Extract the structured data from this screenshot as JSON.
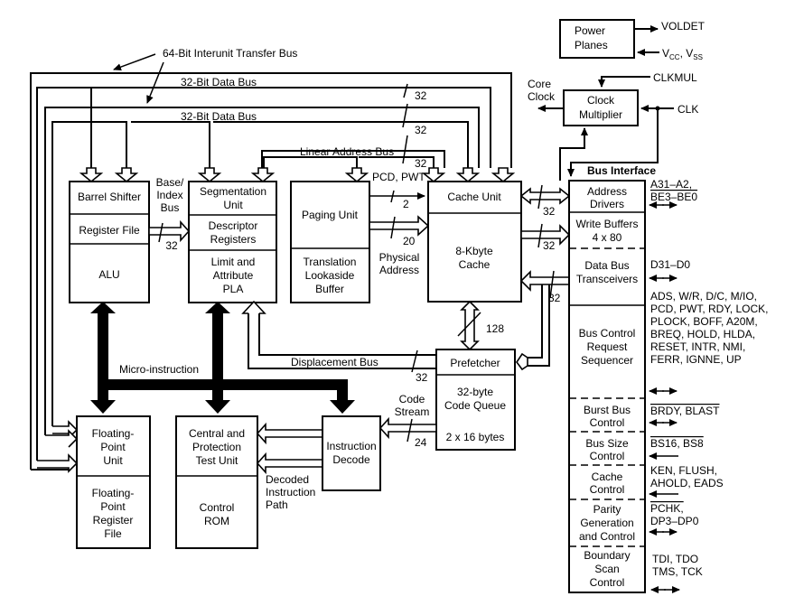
{
  "title_annotation": "64-Bit Interunit Transfer Bus",
  "buses": {
    "data_bus_1": "32-Bit Data Bus",
    "data_bus_2": "32-Bit Data Bus",
    "linear_address_bus": "Linear Address Bus",
    "displacement_bus": "Displacement Bus",
    "micro_instruction": "Micro-instruction",
    "base_index_bus": [
      "Base/",
      "Index",
      "Bus"
    ],
    "physical_address": [
      "Physical",
      "Address"
    ],
    "pcd_pwt": "PCD, PWT",
    "code_stream": [
      "Code",
      "Stream"
    ],
    "decoded_instruction_path": [
      "Decoded",
      "Instruction",
      "Path"
    ],
    "core_clock": [
      "Core",
      "Clock"
    ]
  },
  "widths": {
    "w32_a": "32",
    "w32_b": "32",
    "w32_c": "32",
    "w32_base": "32",
    "w2": "2",
    "w20": "20",
    "w32_bi1": "32",
    "w32_bi2": "32",
    "w32_bi3": "32",
    "w128": "128",
    "w32_disp": "32",
    "w24": "24"
  },
  "blocks": {
    "barrel_shifter": [
      "Barrel Shifter"
    ],
    "register_file": [
      "Register File"
    ],
    "alu": [
      "ALU"
    ],
    "segmentation_unit": [
      "Segmentation",
      "Unit"
    ],
    "descriptor_registers": [
      "Descriptor",
      "Registers"
    ],
    "limit_attribute_pla": [
      "Limit and",
      "Attribute",
      "PLA"
    ],
    "paging_unit": [
      "Paging Unit"
    ],
    "tlb": [
      "Translation",
      "Lookaside",
      "Buffer"
    ],
    "cache_unit": [
      "Cache Unit"
    ],
    "cache_8k": [
      "8-Kbyte",
      "Cache"
    ],
    "prefetcher": [
      "Prefetcher"
    ],
    "code_queue": [
      "32-byte",
      "Code Queue"
    ],
    "code_queue_size": [
      "2 x 16 bytes"
    ],
    "instruction_decode": [
      "Instruction",
      "Decode"
    ],
    "fpu": [
      "Floating-",
      "Point",
      "Unit"
    ],
    "fp_register_file": [
      "Floating-",
      "Point",
      "Register",
      "File"
    ],
    "central_protection": [
      "Central and",
      "Protection",
      "Test Unit"
    ],
    "control_rom": [
      "Control",
      "ROM"
    ],
    "power_planes": [
      "Power",
      "Planes"
    ],
    "clock_multiplier": [
      "Clock",
      "Multiplier"
    ]
  },
  "power": {
    "voldet": "VOLDET",
    "vcc_vss": "V",
    "vcc_sub": "CC",
    "vss_sub": "SS"
  },
  "clock": {
    "clkmul": "CLKMUL",
    "clk": "CLK"
  },
  "bus_interface": {
    "title": "Bus Interface",
    "sections": [
      [
        "Address",
        "Drivers"
      ],
      [
        "Write Buffers",
        "4 x 80"
      ],
      [
        "Data Bus",
        "Transceivers"
      ],
      [
        "Bus Control",
        "Request",
        "Sequencer"
      ],
      [
        "Burst Bus",
        "Control"
      ],
      [
        "Bus Size",
        "Control"
      ],
      [
        "Cache",
        "Control"
      ],
      [
        "Parity",
        "Generation",
        "and Control"
      ],
      [
        "Boundary",
        "Scan",
        "Control"
      ]
    ]
  },
  "signals": {
    "address": [
      "A31–A2,",
      "BE3–BE0"
    ],
    "data": [
      "D31–D0"
    ],
    "bus_control": [
      "ADS, W/R, D/C, M/IO,",
      "PCD, PWT, RDY, LOCK,",
      "PLOCK, BOFF, A20M,",
      "BREQ, HOLD, HLDA,",
      "RESET, INTR, NMI,",
      "FERR, IGNNE, UP"
    ],
    "burst": [
      "BRDY, BLAST"
    ],
    "bus_size": [
      "BS16, BS8"
    ],
    "cache": [
      "KEN, FLUSH,",
      "AHOLD, EADS"
    ],
    "parity": [
      "PCHK,",
      "DP3–DP0"
    ],
    "boundary": [
      "TDI, TDO",
      "TMS, TCK"
    ]
  }
}
